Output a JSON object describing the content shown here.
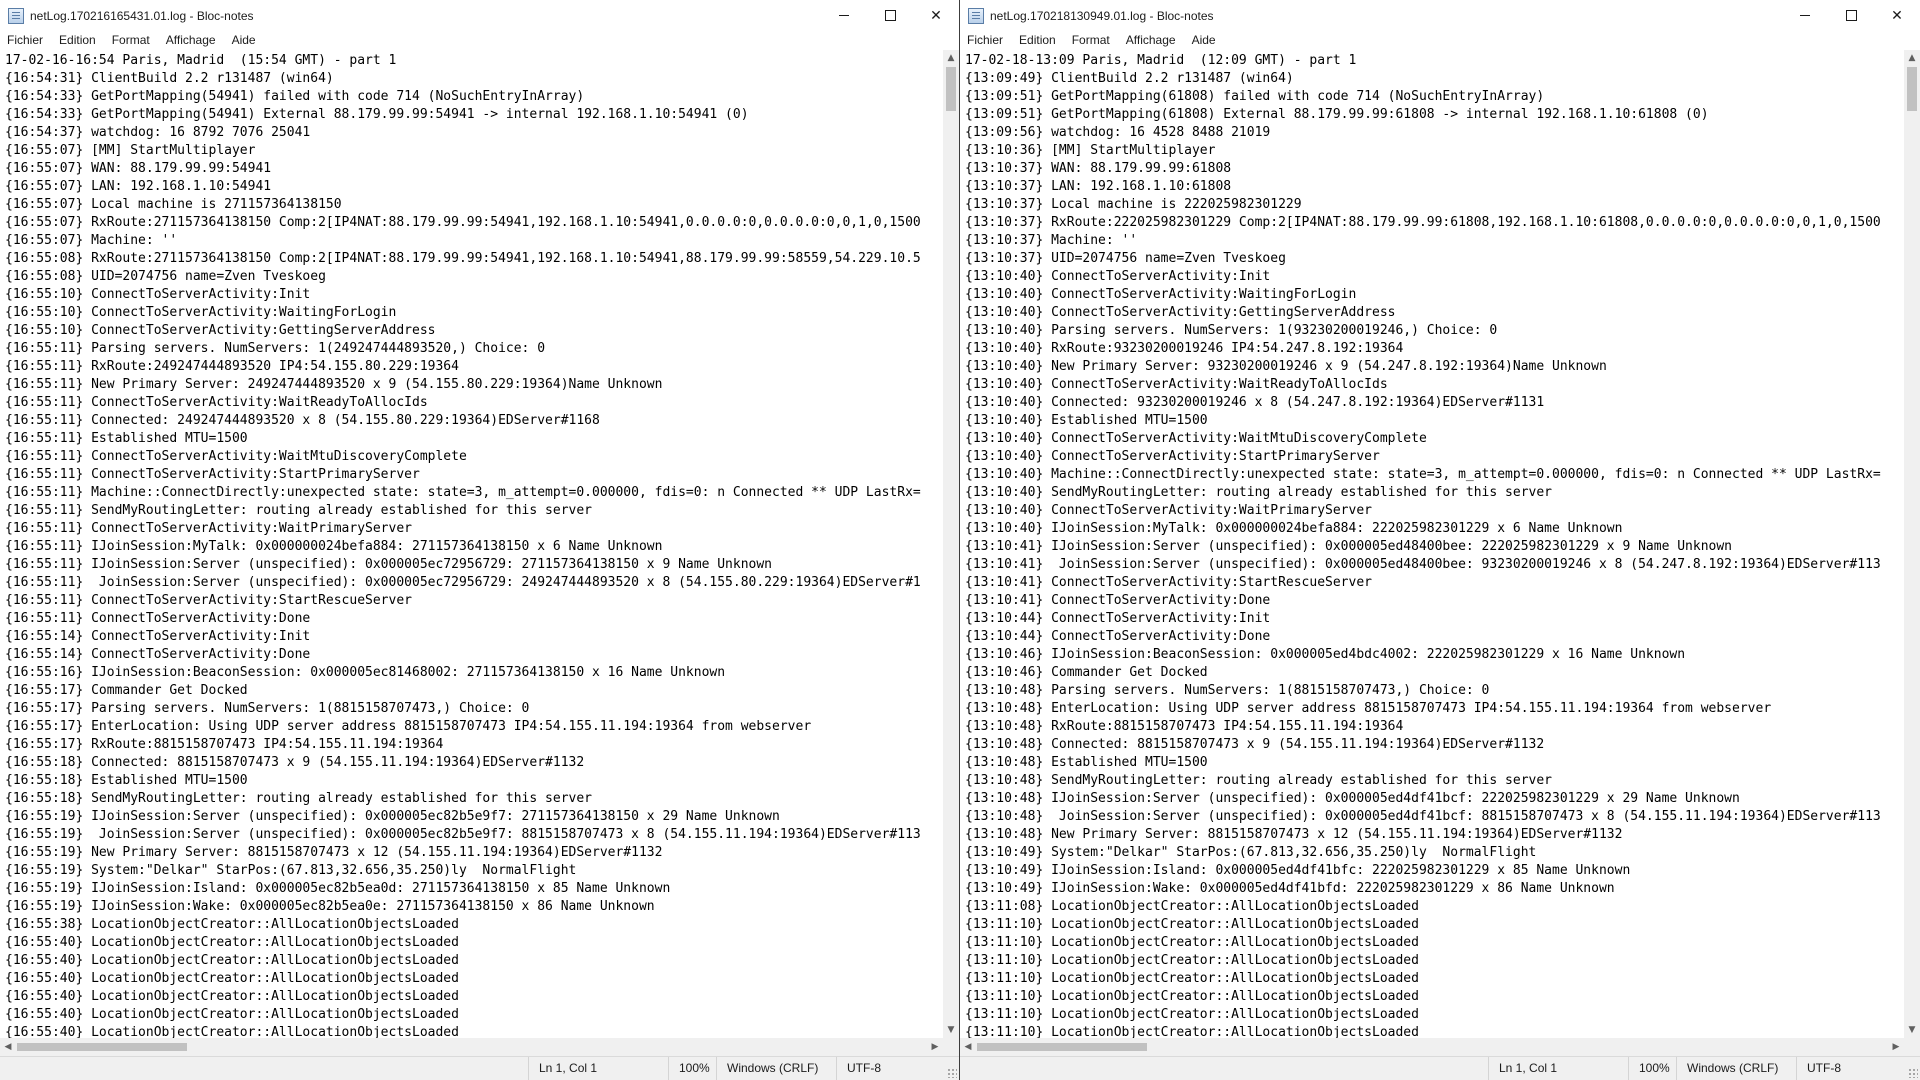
{
  "windows": [
    {
      "title": "netLog.170216165431.01.log - Bloc-notes",
      "menu": [
        "Fichier",
        "Edition",
        "Format",
        "Affichage",
        "Aide"
      ],
      "lines": [
        "17-02-16-16:54 Paris, Madrid  (15:54 GMT) - part 1",
        "{16:54:31} ClientBuild 2.2 r131487 (win64)",
        "{16:54:33} GetPortMapping(54941) failed with code 714 (NoSuchEntryInArray)",
        "{16:54:33} GetPortMapping(54941) External 88.179.99.99:54941 -> internal 192.168.1.10:54941 (0)",
        "{16:54:37} watchdog: 16 8792 7076 25041",
        "{16:55:07} [MM] StartMultiplayer",
        "{16:55:07} WAN: 88.179.99.99:54941",
        "{16:55:07} LAN: 192.168.1.10:54941",
        "{16:55:07} Local machine is 271157364138150",
        "{16:55:07} RxRoute:271157364138150 Comp:2[IP4NAT:88.179.99.99:54941,192.168.1.10:54941,0.0.0.0:0,0.0.0.0:0,0,1,0,1500",
        "{16:55:07} Machine: ''",
        "{16:55:08} RxRoute:271157364138150 Comp:2[IP4NAT:88.179.99.99:54941,192.168.1.10:54941,88.179.99.99:58559,54.229.10.5",
        "{16:55:08} UID=2074756 name=Zven Tveskoeg",
        "{16:55:10} ConnectToServerActivity:Init",
        "{16:55:10} ConnectToServerActivity:WaitingForLogin",
        "{16:55:10} ConnectToServerActivity:GettingServerAddress",
        "{16:55:11} Parsing servers. NumServers: 1(249247444893520,) Choice: 0",
        "{16:55:11} RxRoute:249247444893520 IP4:54.155.80.229:19364",
        "{16:55:11} New Primary Server: 249247444893520 x 9 (54.155.80.229:19364)Name Unknown",
        "{16:55:11} ConnectToServerActivity:WaitReadyToAllocIds",
        "{16:55:11} Connected: 249247444893520 x 8 (54.155.80.229:19364)EDServer#1168",
        "{16:55:11} Established MTU=1500",
        "{16:55:11} ConnectToServerActivity:WaitMtuDiscoveryComplete",
        "{16:55:11} ConnectToServerActivity:StartPrimaryServer",
        "{16:55:11} Machine::ConnectDirectly:unexpected state: state=3, m_attempt=0.000000, fdis=0: n Connected ** UDP LastRx=",
        "{16:55:11} SendMyRoutingLetter: routing already established for this server",
        "{16:55:11} ConnectToServerActivity:WaitPrimaryServer",
        "{16:55:11} IJoinSession:MyTalk: 0x000000024befa884: 271157364138150 x 6 Name Unknown",
        "{16:55:11} IJoinSession:Server (unspecified): 0x000005ec72956729: 271157364138150 x 9 Name Unknown",
        "{16:55:11}  JoinSession:Server (unspecified): 0x000005ec72956729: 249247444893520 x 8 (54.155.80.229:19364)EDServer#1",
        "{16:55:11} ConnectToServerActivity:StartRescueServer",
        "{16:55:11} ConnectToServerActivity:Done",
        "{16:55:14} ConnectToServerActivity:Init",
        "{16:55:14} ConnectToServerActivity:Done",
        "{16:55:16} IJoinSession:BeaconSession: 0x000005ec81468002: 271157364138150 x 16 Name Unknown",
        "{16:55:17} Commander Get Docked",
        "{16:55:17} Parsing servers. NumServers: 1(8815158707473,) Choice: 0",
        "{16:55:17} EnterLocation: Using UDP server address 8815158707473 IP4:54.155.11.194:19364 from webserver",
        "{16:55:17} RxRoute:8815158707473 IP4:54.155.11.194:19364",
        "{16:55:18} Connected: 8815158707473 x 9 (54.155.11.194:19364)EDServer#1132",
        "{16:55:18} Established MTU=1500",
        "{16:55:18} SendMyRoutingLetter: routing already established for this server",
        "{16:55:19} IJoinSession:Server (unspecified): 0x000005ec82b5e9f7: 271157364138150 x 29 Name Unknown",
        "{16:55:19}  JoinSession:Server (unspecified): 0x000005ec82b5e9f7: 8815158707473 x 8 (54.155.11.194:19364)EDServer#113",
        "{16:55:19} New Primary Server: 8815158707473 x 12 (54.155.11.194:19364)EDServer#1132",
        "{16:55:19} System:\"Delkar\" StarPos:(67.813,32.656,35.250)ly  NormalFlight",
        "{16:55:19} IJoinSession:Island: 0x000005ec82b5ea0d: 271157364138150 x 85 Name Unknown",
        "{16:55:19} IJoinSession:Wake: 0x000005ec82b5ea0e: 271157364138150 x 86 Name Unknown",
        "{16:55:38} LocationObjectCreator::AllLocationObjectsLoaded",
        "{16:55:40} LocationObjectCreator::AllLocationObjectsLoaded",
        "{16:55:40} LocationObjectCreator::AllLocationObjectsLoaded",
        "{16:55:40} LocationObjectCreator::AllLocationObjectsLoaded",
        "{16:55:40} LocationObjectCreator::AllLocationObjectsLoaded",
        "{16:55:40} LocationObjectCreator::AllLocationObjectsLoaded",
        "{16:55:40} LocationObjectCreator::AllLocationObjectsLoaded"
      ],
      "status": {
        "position": "Ln 1, Col 1",
        "zoom": "100%",
        "eol": "Windows (CRLF)",
        "encoding": "UTF-8"
      }
    },
    {
      "title": "netLog.170218130949.01.log - Bloc-notes",
      "menu": [
        "Fichier",
        "Edition",
        "Format",
        "Affichage",
        "Aide"
      ],
      "lines": [
        "17-02-18-13:09 Paris, Madrid  (12:09 GMT) - part 1",
        "{13:09:49} ClientBuild 2.2 r131487 (win64)",
        "{13:09:51} GetPortMapping(61808) failed with code 714 (NoSuchEntryInArray)",
        "{13:09:51} GetPortMapping(61808) External 88.179.99.99:61808 -> internal 192.168.1.10:61808 (0)",
        "{13:09:56} watchdog: 16 4528 8488 21019",
        "{13:10:36} [MM] StartMultiplayer",
        "{13:10:37} WAN: 88.179.99.99:61808",
        "{13:10:37} LAN: 192.168.1.10:61808",
        "{13:10:37} Local machine is 222025982301229",
        "{13:10:37} RxRoute:222025982301229 Comp:2[IP4NAT:88.179.99.99:61808,192.168.1.10:61808,0.0.0.0:0,0.0.0.0:0,0,1,0,1500",
        "{13:10:37} Machine: ''",
        "{13:10:37} UID=2074756 name=Zven Tveskoeg",
        "{13:10:40} ConnectToServerActivity:Init",
        "{13:10:40} ConnectToServerActivity:WaitingForLogin",
        "{13:10:40} ConnectToServerActivity:GettingServerAddress",
        "{13:10:40} Parsing servers. NumServers: 1(93230200019246,) Choice: 0",
        "{13:10:40} RxRoute:93230200019246 IP4:54.247.8.192:19364",
        "{13:10:40} New Primary Server: 93230200019246 x 9 (54.247.8.192:19364)Name Unknown",
        "{13:10:40} ConnectToServerActivity:WaitReadyToAllocIds",
        "{13:10:40} Connected: 93230200019246 x 8 (54.247.8.192:19364)EDServer#1131",
        "{13:10:40} Established MTU=1500",
        "{13:10:40} ConnectToServerActivity:WaitMtuDiscoveryComplete",
        "{13:10:40} ConnectToServerActivity:StartPrimaryServer",
        "{13:10:40} Machine::ConnectDirectly:unexpected state: state=3, m_attempt=0.000000, fdis=0: n Connected ** UDP LastRx=",
        "{13:10:40} SendMyRoutingLetter: routing already established for this server",
        "{13:10:40} ConnectToServerActivity:WaitPrimaryServer",
        "{13:10:40} IJoinSession:MyTalk: 0x000000024befa884: 222025982301229 x 6 Name Unknown",
        "{13:10:41} IJoinSession:Server (unspecified): 0x000005ed48400bee: 222025982301229 x 9 Name Unknown",
        "{13:10:41}  JoinSession:Server (unspecified): 0x000005ed48400bee: 93230200019246 x 8 (54.247.8.192:19364)EDServer#113",
        "{13:10:41} ConnectToServerActivity:StartRescueServer",
        "{13:10:41} ConnectToServerActivity:Done",
        "{13:10:44} ConnectToServerActivity:Init",
        "{13:10:44} ConnectToServerActivity:Done",
        "{13:10:46} IJoinSession:BeaconSession: 0x000005ed4bdc4002: 222025982301229 x 16 Name Unknown",
        "{13:10:46} Commander Get Docked",
        "{13:10:48} Parsing servers. NumServers: 1(8815158707473,) Choice: 0",
        "{13:10:48} EnterLocation: Using UDP server address 8815158707473 IP4:54.155.11.194:19364 from webserver",
        "{13:10:48} RxRoute:8815158707473 IP4:54.155.11.194:19364",
        "{13:10:48} Connected: 8815158707473 x 9 (54.155.11.194:19364)EDServer#1132",
        "{13:10:48} Established MTU=1500",
        "{13:10:48} SendMyRoutingLetter: routing already established for this server",
        "{13:10:48} IJoinSession:Server (unspecified): 0x000005ed4df41bcf: 222025982301229 x 29 Name Unknown",
        "{13:10:48}  JoinSession:Server (unspecified): 0x000005ed4df41bcf: 8815158707473 x 8 (54.155.11.194:19364)EDServer#113",
        "{13:10:48} New Primary Server: 8815158707473 x 12 (54.155.11.194:19364)EDServer#1132",
        "{13:10:49} System:\"Delkar\" StarPos:(67.813,32.656,35.250)ly  NormalFlight",
        "{13:10:49} IJoinSession:Island: 0x000005ed4df41bfc: 222025982301229 x 85 Name Unknown",
        "{13:10:49} IJoinSession:Wake: 0x000005ed4df41bfd: 222025982301229 x 86 Name Unknown",
        "{13:11:08} LocationObjectCreator::AllLocationObjectsLoaded",
        "{13:11:10} LocationObjectCreator::AllLocationObjectsLoaded",
        "{13:11:10} LocationObjectCreator::AllLocationObjectsLoaded",
        "{13:11:10} LocationObjectCreator::AllLocationObjectsLoaded",
        "{13:11:10} LocationObjectCreator::AllLocationObjectsLoaded",
        "{13:11:10} LocationObjectCreator::AllLocationObjectsLoaded",
        "{13:11:10} LocationObjectCreator::AllLocationObjectsLoaded",
        "{13:11:10} LocationObjectCreator::AllLocationObjectsLoaded"
      ],
      "status": {
        "position": "Ln 1, Col 1",
        "zoom": "100%",
        "eol": "Windows (CRLF)",
        "encoding": "UTF-8"
      }
    }
  ]
}
